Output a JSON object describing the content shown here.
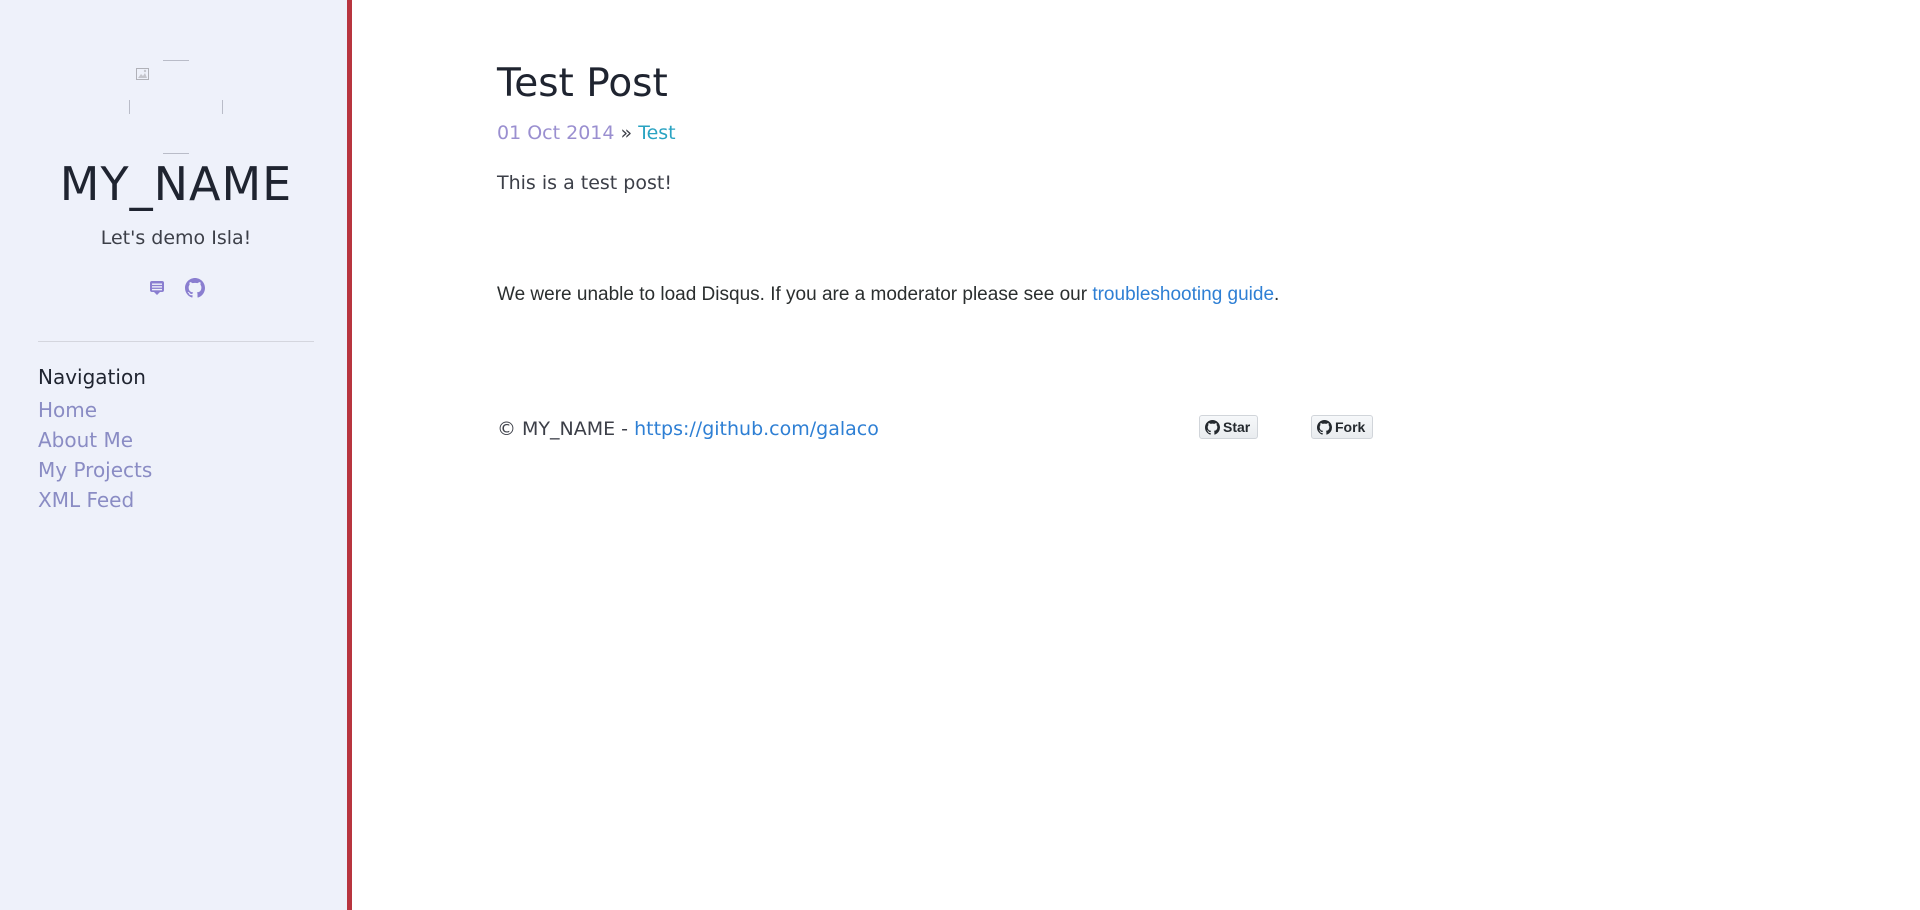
{
  "sidebar": {
    "author_name": "MY_NAME",
    "tagline": "Let's demo Isla!",
    "social": [
      {
        "icon": "feed-icon"
      },
      {
        "icon": "github-icon"
      }
    ],
    "nav": {
      "heading": "Navigation",
      "items": [
        {
          "label": "Home"
        },
        {
          "label": "About Me"
        },
        {
          "label": "My Projects"
        },
        {
          "label": "XML Feed"
        }
      ]
    }
  },
  "post": {
    "title": "Test Post",
    "date": "01 Oct 2014",
    "separator": "»",
    "category": "Test",
    "body": "This is a test post!"
  },
  "disqus": {
    "message": "We were unable to load Disqus. If you are a moderator please see our",
    "link_text": "troubleshooting guide",
    "suffix": "."
  },
  "footer": {
    "copyright": "© MY_NAME -",
    "link_text": "https://github.com/galaco",
    "star_label": "Star",
    "fork_label": "Fork"
  },
  "colors": {
    "sidebar_bg": "#eef1fa",
    "sidebar_border": "#b8353f",
    "link": "#2e7fd4",
    "nav_link": "#8a8cc4",
    "date": "#9a8fd0",
    "category": "#2aa3c2"
  }
}
